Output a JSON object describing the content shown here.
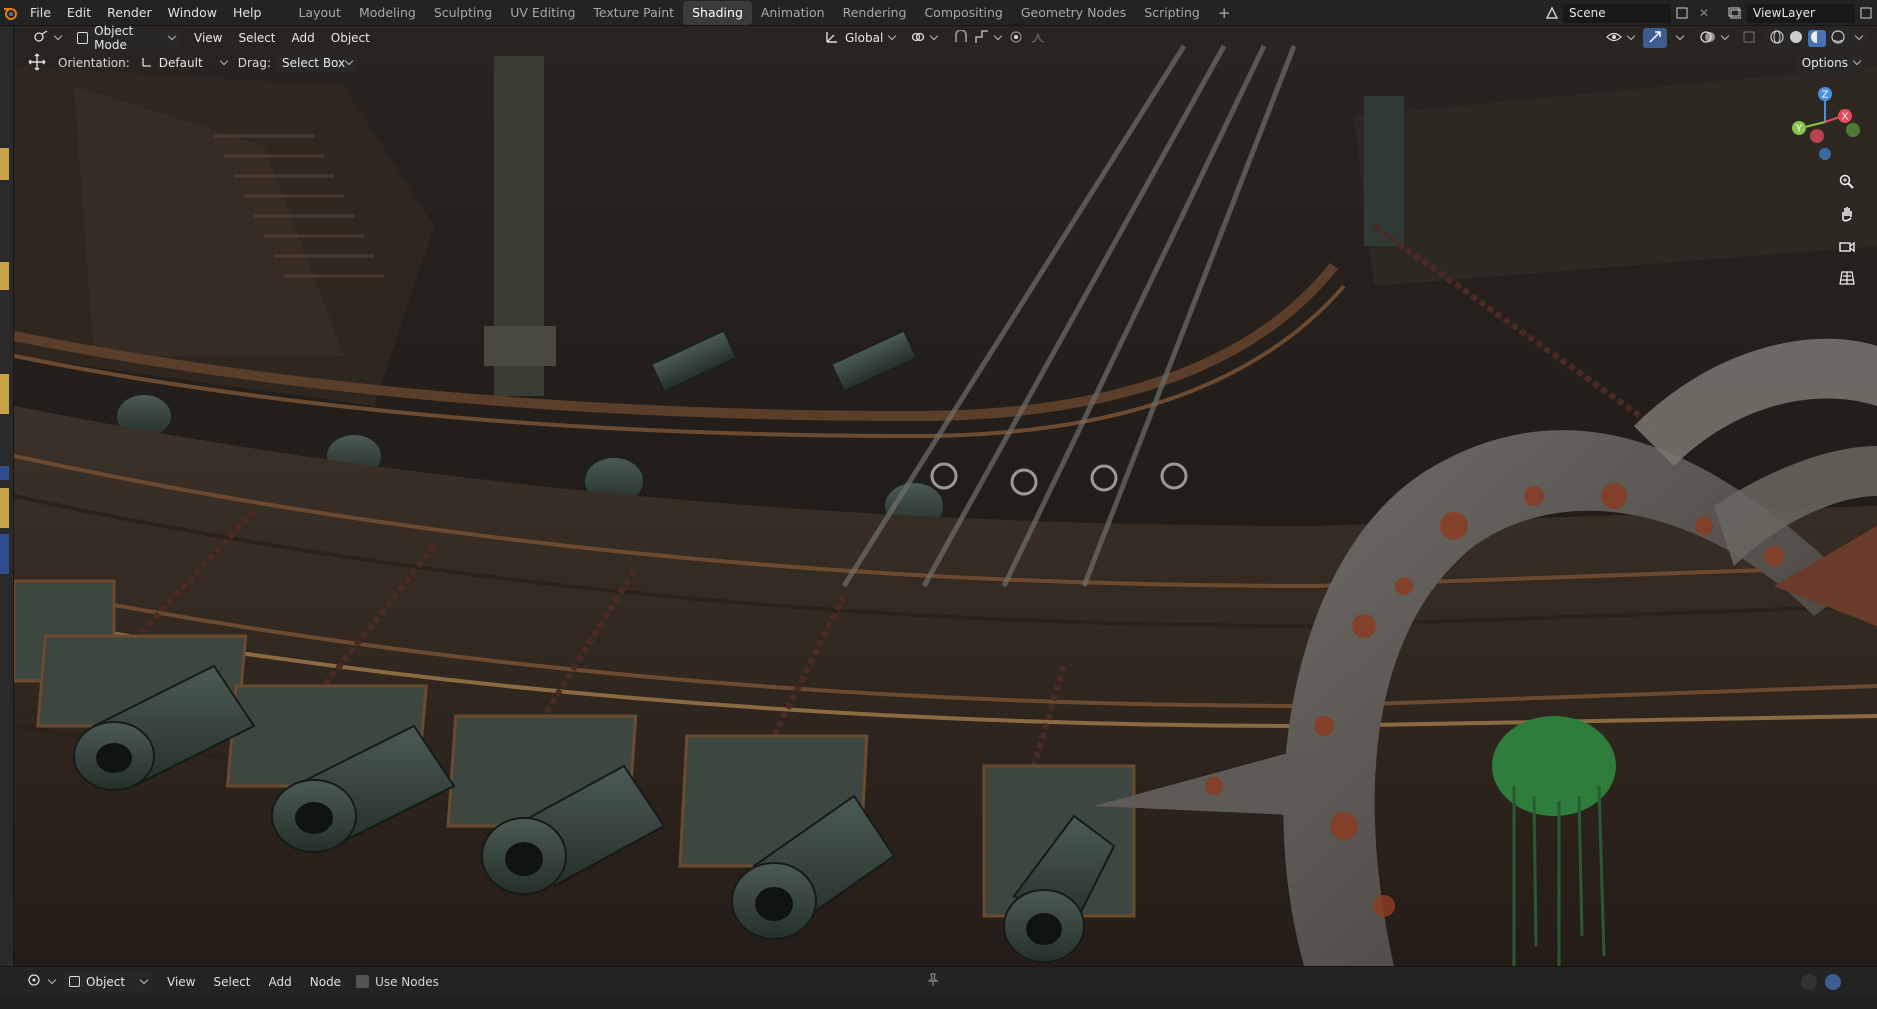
{
  "topbar": {
    "menu": [
      "File",
      "Edit",
      "Render",
      "Window",
      "Help"
    ],
    "workspaces": [
      "Layout",
      "Modeling",
      "Sculpting",
      "UV Editing",
      "Texture Paint",
      "Shading",
      "Animation",
      "Rendering",
      "Compositing",
      "Geometry Nodes",
      "Scripting"
    ],
    "active_workspace": "Shading",
    "scene": "Scene",
    "view_layer": "ViewLayer"
  },
  "viewport_header": {
    "mode": "Object Mode",
    "menus": [
      "View",
      "Select",
      "Add",
      "Object"
    ],
    "transform_orientation": "Global",
    "options_label": "Options"
  },
  "tool_settings": {
    "orientation_label": "Orientation:",
    "orientation_value": "Default",
    "drag_label": "Drag:",
    "drag_value": "Select Box"
  },
  "gizmo": {
    "z": "Z",
    "y": "Y",
    "x": "X"
  },
  "node_editor_header": {
    "object_type": "Object",
    "menus": [
      "View",
      "Select",
      "Add",
      "Node"
    ],
    "use_nodes_label": "Use Nodes"
  },
  "colors": {
    "accent_blue": "#4772b3",
    "axis_x": "#e44b5a",
    "axis_y": "#8bc34a",
    "axis_z": "#4a90e2",
    "wood": "#3a2f27",
    "rust": "#8a3c22",
    "moss": "#2f7d3a"
  },
  "icons": [
    "blender-logo-icon",
    "editor-type-icon",
    "object-mode-icon",
    "move-tool-icon",
    "transform-global-icon",
    "pivot-icon",
    "snap-icon",
    "proportional-icon",
    "visibility-icon",
    "gizmo-icon",
    "overlay-icon",
    "xray-icon",
    "wireframe-shading-icon",
    "solid-shading-icon",
    "material-shading-icon",
    "rendered-shading-icon",
    "zoom-icon",
    "hand-pan-icon",
    "camera-icon",
    "grid-ortho-icon",
    "pin-icon"
  ]
}
